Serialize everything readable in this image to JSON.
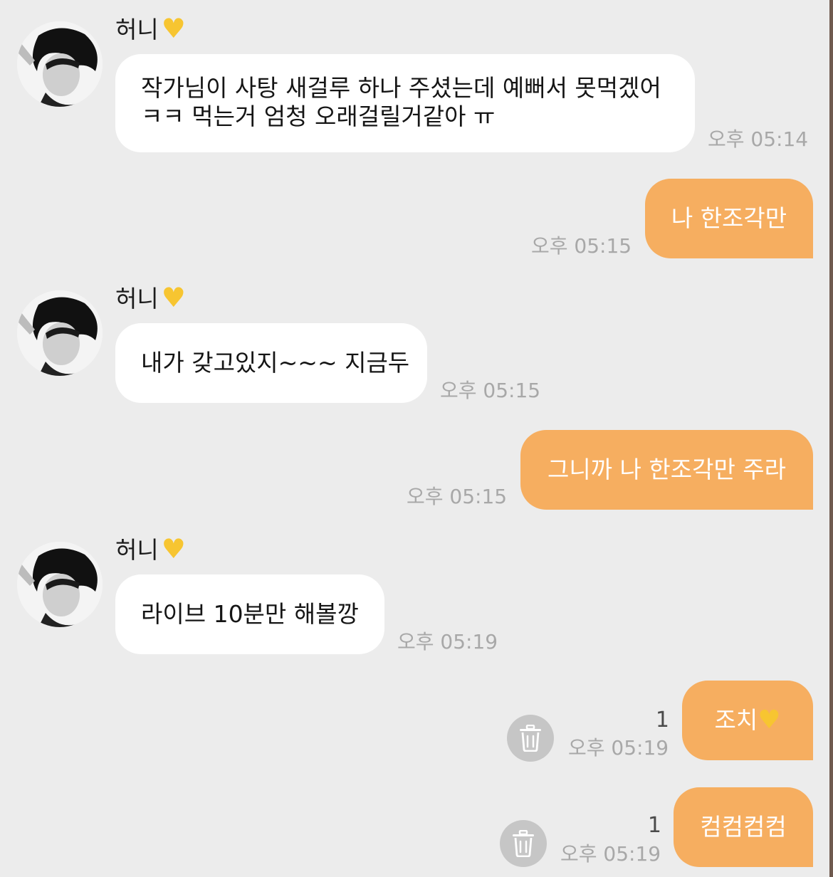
{
  "sender_name": "허니",
  "heart_glyph": "♥",
  "colors": {
    "background": "#ececec",
    "incoming_bubble": "#ffffff",
    "outgoing_bubble": "#f6ae60",
    "timestamp": "#a8a8a8",
    "heart": "#f7c531"
  },
  "messages": [
    {
      "direction": "incoming",
      "lines": [
        "작가님이 사탕 새걸루 하나 주셨는데 예뻐서 못먹겠어",
        "ㅋㅋ 먹는거 엄청 오래걸릴거같아 ㅠ"
      ],
      "time": "오후 05:14"
    },
    {
      "direction": "outgoing",
      "text": "나 한조각만",
      "time": "오후 05:15"
    },
    {
      "direction": "incoming",
      "text": "내가 갖고있지~~~ 지금두",
      "time": "오후 05:15"
    },
    {
      "direction": "outgoing",
      "text": "그니까 나 한조각만 주라",
      "time": "오후 05:15"
    },
    {
      "direction": "incoming",
      "text": "라이브 10분만 해볼깡",
      "time": "오후 05:19"
    },
    {
      "direction": "outgoing",
      "text": "조치",
      "time": "오후 05:19",
      "unread": "1",
      "trash_icon": "trash-icon"
    },
    {
      "direction": "outgoing",
      "text": "컴컴컴컴",
      "time": "오후 05:19",
      "unread": "1",
      "trash_icon": "trash-icon"
    }
  ]
}
